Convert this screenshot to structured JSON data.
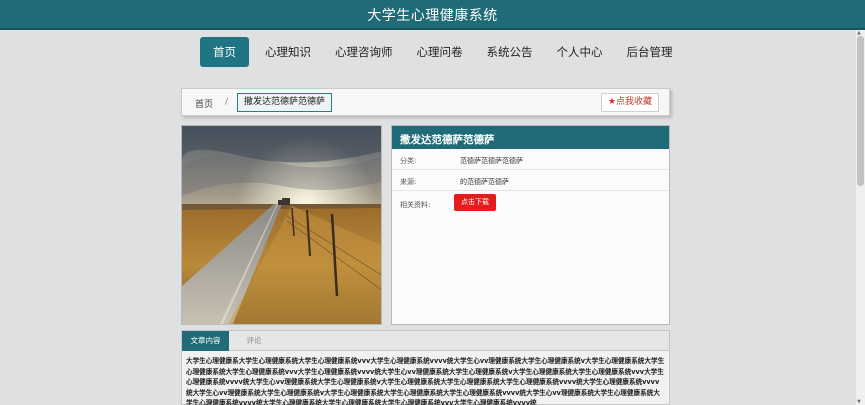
{
  "app_title": "大学生心理健康系统",
  "nav": [
    {
      "label": "首页",
      "active": true
    },
    {
      "label": "心理知识"
    },
    {
      "label": "心理咨询师"
    },
    {
      "label": "心理问卷"
    },
    {
      "label": "系统公告"
    },
    {
      "label": "个人中心"
    },
    {
      "label": "后台管理"
    }
  ],
  "breadcrumb": {
    "home": "首页",
    "separator": "/",
    "current": "撒发达范德萨范德萨"
  },
  "favorite_label": "★点我收藏",
  "article": {
    "title": "撒发达范德萨范德萨",
    "category_label": "分类:",
    "category_value": "范德萨范德萨范德萨",
    "source_label": "来源:",
    "source_value": "的范德萨范德萨",
    "resource_label": "相关资料:",
    "download_label": "点击下载"
  },
  "tabs": [
    {
      "label": "文章内容",
      "active": true
    },
    {
      "label": "评论"
    }
  ],
  "content_text": "大学生心理健康系大学生心理健康系统大学生心理健康系统vvv大学生心理健康系统vvvv统大学生心vv理健康系统大学生心理健康系统v大学生心理健康系统大学生心理健康系统大学生心理健康系统vvv大学生心理健康系统vvvv统大学生心vv理健康系统大学生心理健康系统v大学生心理健康系统大学生心理健康系统vvv大学生心理健康系统vvvv统大学生心vv理健康系统大学生心理健康系统v大学生心理健康系统大学生心理健康系统大学生心理健康系统vvvv统大学生心理健康系统vvvv统大学生心vv理健康系统大学生心理健康系统v大学生心理健康系统大学生心理健康系统大学生心理健康系统vvvv统大学生心vv理健康系统大学生心理健康系统大学生心理健康系统vvvv统大学生心理健康系统大学生心理健康系统大学生心理健康系统vvv大学生心理健康系统vvvv统",
  "colors": {
    "brand": "#1f6b78",
    "download": "#e51c1c",
    "favorite": "#c0392b"
  }
}
